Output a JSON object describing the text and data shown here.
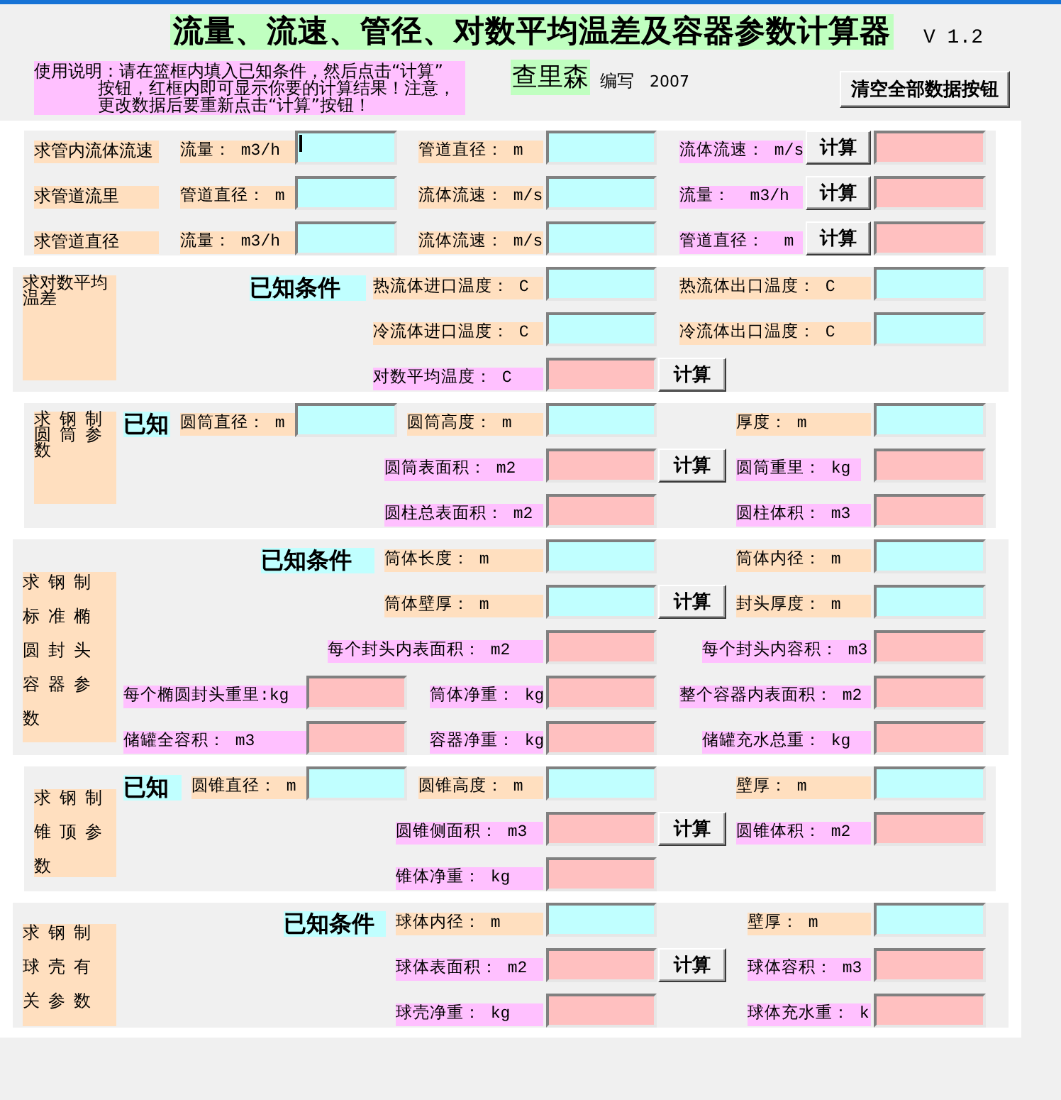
{
  "window": {
    "title": "流量、流速、管径、对数平均温差及容器参数计算器",
    "version": "V 1.2"
  },
  "header": {
    "instructions": "使用说明：请在篮框内填入已知条件，然后点击“计算”按钮，红框内即可显示你要的计算结果！注意，更改数据后要重新点击“计算”按钮！",
    "author": "查里森",
    "credit": "编写",
    "year": "2007",
    "clear_button": "清空全部数据按钮"
  },
  "sections": [
    {
      "rows": [
        {
          "items": [
            {
              "kind": "task",
              "text": "求管内流体流速"
            },
            {
              "kind": "input_label",
              "text": "流量： m3/h"
            },
            {
              "kind": "input_field",
              "focused": true
            },
            {
              "kind": "input_label",
              "text": "管道直径： m"
            },
            {
              "kind": "input_field",
              "focused": false
            },
            {
              "kind": "output_label",
              "text": "流体流速： m/s"
            },
            {
              "kind": "button",
              "text": "计算"
            },
            {
              "kind": "output_field",
              "focused": false
            }
          ]
        },
        {
          "items": [
            {
              "kind": "task",
              "text": "求管道流里"
            },
            {
              "kind": "input_label",
              "text": "管道直径： m"
            },
            {
              "kind": "input_field",
              "focused": false
            },
            {
              "kind": "input_label",
              "text": "流体流速： m/s"
            },
            {
              "kind": "input_field",
              "focused": false
            },
            {
              "kind": "output_label",
              "text": "流量：  m3/h"
            },
            {
              "kind": "button",
              "text": "计算"
            },
            {
              "kind": "output_field",
              "focused": false
            }
          ]
        },
        {
          "items": [
            {
              "kind": "task",
              "text": "求管道直径"
            },
            {
              "kind": "input_label",
              "text": "流量： m3/h"
            },
            {
              "kind": "input_field",
              "focused": false
            },
            {
              "kind": "input_label",
              "text": "流体流速： m/s"
            },
            {
              "kind": "input_field",
              "focused": false
            },
            {
              "kind": "output_label",
              "text": "管道直径：  m"
            },
            {
              "kind": "button",
              "text": "计算"
            },
            {
              "kind": "output_field",
              "focused": false
            }
          ]
        }
      ]
    },
    {
      "title": "求对数平均温差",
      "rows": [
        {
          "items": [
            {
              "kind": "heading",
              "text": "已知条件"
            },
            {
              "kind": "input_label",
              "text": "热流体进口温度： C"
            },
            {
              "kind": "input_field",
              "focused": false
            },
            {
              "kind": "input_label",
              "text": "热流体出口温度： C"
            },
            {
              "kind": "input_field",
              "focused": false
            }
          ]
        },
        {
          "items": [
            {
              "kind": "input_label",
              "text": "冷流体进口温度： C"
            },
            {
              "kind": "input_field",
              "focused": false
            },
            {
              "kind": "input_label",
              "text": "冷流体出口温度： C"
            },
            {
              "kind": "input_field",
              "focused": false
            }
          ]
        },
        {
          "items": [
            {
              "kind": "output_label",
              "text": "对数平均温度： C"
            },
            {
              "kind": "output_field",
              "focused": false
            },
            {
              "kind": "button",
              "text": "计算"
            }
          ]
        }
      ]
    },
    {
      "title": "求钢制圆筒参数",
      "rows": [
        {
          "items": [
            {
              "kind": "heading",
              "text": "已知"
            },
            {
              "kind": "input_label",
              "text": "圆筒直径： m"
            },
            {
              "kind": "input_field",
              "focused": false
            },
            {
              "kind": "input_label",
              "text": "圆筒高度： m"
            },
            {
              "kind": "input_field",
              "focused": false
            },
            {
              "kind": "input_label",
              "text": "厚度： m"
            },
            {
              "kind": "input_field",
              "focused": false
            }
          ]
        },
        {
          "items": [
            {
              "kind": "output_label",
              "text": "圆筒表面积： m2"
            },
            {
              "kind": "output_field",
              "focused": false
            },
            {
              "kind": "button",
              "text": "计算"
            },
            {
              "kind": "output_label",
              "text": "圆筒重里： kg"
            },
            {
              "kind": "output_field",
              "focused": false
            }
          ]
        },
        {
          "items": [
            {
              "kind": "output_label",
              "text": "圆柱总表面积： m2"
            },
            {
              "kind": "output_field",
              "focused": false
            },
            {
              "kind": "output_label",
              "text": "圆柱体积： m3"
            },
            {
              "kind": "output_field",
              "focused": false
            }
          ]
        }
      ]
    },
    {
      "title": "求钢制标准椭圆封头容器参数",
      "rows": [
        {
          "items": [
            {
              "kind": "heading",
              "text": "已知条件"
            },
            {
              "kind": "input_label",
              "text": "筒体长度： m"
            },
            {
              "kind": "input_field",
              "focused": false
            },
            {
              "kind": "input_label",
              "text": "筒体内径： m"
            },
            {
              "kind": "input_field",
              "focused": false
            }
          ]
        },
        {
          "items": [
            {
              "kind": "input_label",
              "text": "筒体壁厚： m"
            },
            {
              "kind": "input_field",
              "focused": false
            },
            {
              "kind": "button",
              "text": "计算"
            },
            {
              "kind": "input_label",
              "text": "封头厚度： m"
            },
            {
              "kind": "input_field",
              "focused": false
            }
          ]
        },
        {
          "items": [
            {
              "kind": "output_label",
              "text": "每个封头内表面积： m2"
            },
            {
              "kind": "output_field",
              "focused": false
            },
            {
              "kind": "output_label",
              "text": "每个封头内容积： m3"
            },
            {
              "kind": "output_field",
              "focused": false
            }
          ]
        },
        {
          "items": [
            {
              "kind": "output_label",
              "text": "每个椭圆封头重里:kg"
            },
            {
              "kind": "output_field",
              "focused": false
            },
            {
              "kind": "output_label",
              "text": "筒体净重： kg"
            },
            {
              "kind": "output_field",
              "focused": false
            },
            {
              "kind": "output_label",
              "text": "整个容器内表面积： m2"
            },
            {
              "kind": "output_field",
              "focused": false
            }
          ]
        },
        {
          "items": [
            {
              "kind": "output_label",
              "text": "储罐全容积： m3"
            },
            {
              "kind": "output_field",
              "focused": false
            },
            {
              "kind": "output_label",
              "text": "容器净重： kg"
            },
            {
              "kind": "output_field",
              "focused": false
            },
            {
              "kind": "output_label",
              "text": "储罐充水总重： kg"
            },
            {
              "kind": "output_field",
              "focused": false
            }
          ]
        }
      ]
    },
    {
      "title": "求钢制锥顶参数",
      "rows": [
        {
          "items": [
            {
              "kind": "heading",
              "text": "已知"
            },
            {
              "kind": "input_label",
              "text": "圆锥直径： m"
            },
            {
              "kind": "input_field",
              "focused": false
            },
            {
              "kind": "input_label",
              "text": "圆锥高度： m"
            },
            {
              "kind": "input_field",
              "focused": false
            },
            {
              "kind": "input_label",
              "text": "壁厚： m"
            },
            {
              "kind": "input_field",
              "focused": false
            }
          ]
        },
        {
          "items": [
            {
              "kind": "output_label",
              "text": "圆锥侧面积： m3"
            },
            {
              "kind": "output_field",
              "focused": false
            },
            {
              "kind": "button",
              "text": "计算"
            },
            {
              "kind": "output_label",
              "text": "圆锥体积： m2"
            },
            {
              "kind": "output_field",
              "focused": false
            }
          ]
        },
        {
          "items": [
            {
              "kind": "output_label",
              "text": "锥体净重： kg"
            },
            {
              "kind": "output_field",
              "focused": false
            }
          ]
        }
      ]
    },
    {
      "title": "求钢制球壳有关参数",
      "rows": [
        {
          "items": [
            {
              "kind": "heading",
              "text": "已知条件"
            },
            {
              "kind": "input_label",
              "text": "球体内径： m"
            },
            {
              "kind": "input_field",
              "focused": false
            },
            {
              "kind": "input_label",
              "text": "壁厚： m"
            },
            {
              "kind": "input_field",
              "focused": false
            }
          ]
        },
        {
          "items": [
            {
              "kind": "output_label",
              "text": "球体表面积： m2"
            },
            {
              "kind": "output_field",
              "focused": false
            },
            {
              "kind": "button",
              "text": "计算"
            },
            {
              "kind": "output_label",
              "text": "球体容积： m3"
            },
            {
              "kind": "output_field",
              "focused": false
            }
          ]
        },
        {
          "items": [
            {
              "kind": "output_label",
              "text": "球壳净重： kg"
            },
            {
              "kind": "output_field",
              "focused": false
            },
            {
              "kind": "output_label",
              "text": "球体充水重： k"
            },
            {
              "kind": "output_field",
              "focused": false
            }
          ]
        }
      ]
    }
  ]
}
